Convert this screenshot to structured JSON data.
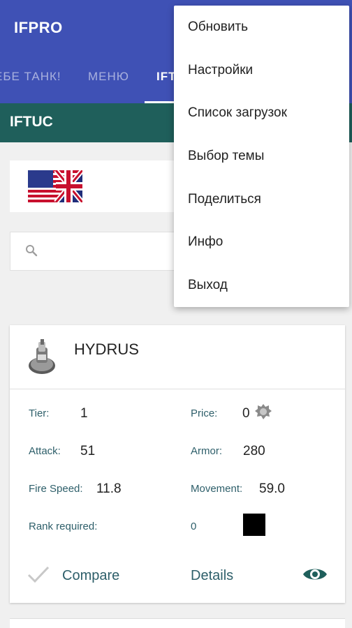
{
  "app": {
    "title": "IFPRO"
  },
  "tabs": [
    {
      "label": "ЕБЕ ТАНК!"
    },
    {
      "label": "МЕНЮ"
    },
    {
      "label": "IFT"
    }
  ],
  "subbar": {
    "title": "IFTUC"
  },
  "search": {
    "placeholder": ""
  },
  "menu": {
    "items": [
      {
        "label": "Обновить"
      },
      {
        "label": "Настройки"
      },
      {
        "label": "Список загрузок"
      },
      {
        "label": "Выбор темы"
      },
      {
        "label": "Поделиться"
      },
      {
        "label": "Инфо"
      },
      {
        "label": "Выход"
      }
    ]
  },
  "tank": {
    "name": "HYDRUS",
    "tier_label": "Tier:",
    "tier_value": "1",
    "price_label": "Price:",
    "price_value": "0",
    "attack_label": "Attack:",
    "attack_value": "51",
    "armor_label": "Armor:",
    "armor_value": "280",
    "fire_speed_label": "Fire Speed:",
    "fire_speed_value": "11.8",
    "movement_label": "Movement:",
    "movement_value": "59.0",
    "rank_label": "Rank required:",
    "rank_value": "0",
    "compare_label": "Compare",
    "details_label": "Details"
  },
  "icons": {
    "flag": "uk-us-flag-icon",
    "search": "search-icon",
    "check": "check-icon",
    "eye": "eye-icon",
    "price": "gear-currency-icon"
  },
  "colors": {
    "appbar": "#3f51b5",
    "subbar": "#1f5f5b",
    "accent_text": "#2e5f6a"
  }
}
